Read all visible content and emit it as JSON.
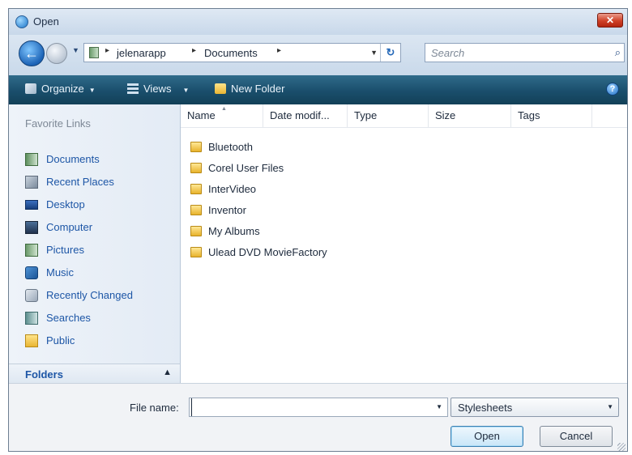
{
  "window": {
    "title": "Open",
    "close_label": "✕"
  },
  "address": {
    "breadcrumbs": [
      "jelenarapp",
      "Documents"
    ],
    "separator": "▸",
    "dropdown_glyph": "▼",
    "refresh_glyph": "↻"
  },
  "search": {
    "placeholder": "Search",
    "icon_glyph": "⌕"
  },
  "toolbar": {
    "organize_label": "Organize",
    "views_label": "Views",
    "new_folder_label": "New Folder",
    "dropdown_glyph": "▼",
    "help_glyph": "?"
  },
  "nav": {
    "header": "Favorite Links",
    "items": [
      {
        "label": "Documents",
        "icon": "documents-icon"
      },
      {
        "label": "Recent Places",
        "icon": "recent-places-icon"
      },
      {
        "label": "Desktop",
        "icon": "desktop-icon"
      },
      {
        "label": "Computer",
        "icon": "computer-icon"
      },
      {
        "label": "Pictures",
        "icon": "pictures-icon"
      },
      {
        "label": "Music",
        "icon": "music-icon"
      },
      {
        "label": "Recently Changed",
        "icon": "recently-changed-icon"
      },
      {
        "label": "Searches",
        "icon": "searches-icon"
      },
      {
        "label": "Public",
        "icon": "public-folder-icon"
      }
    ],
    "folders_label": "Folders",
    "folders_toggle_glyph": "▲"
  },
  "files": {
    "columns": [
      "Name",
      "Date modif...",
      "Type",
      "Size",
      "Tags"
    ],
    "sort_glyph": "▲",
    "rows": [
      {
        "name": "Bluetooth"
      },
      {
        "name": "Corel User Files"
      },
      {
        "name": "InterVideo"
      },
      {
        "name": "Inventor"
      },
      {
        "name": "My Albums"
      },
      {
        "name": "Ulead DVD MovieFactory"
      }
    ]
  },
  "bottom": {
    "file_name_label": "File name:",
    "file_name_value": "",
    "file_type_value": "Stylesheets",
    "dropdown_glyph": "▼",
    "open_label": "Open",
    "cancel_label": "Cancel"
  },
  "colors": {
    "toolbar_bg": "#1a4e6c",
    "link_blue": "#1d56a6",
    "close_red": "#cf4127"
  }
}
